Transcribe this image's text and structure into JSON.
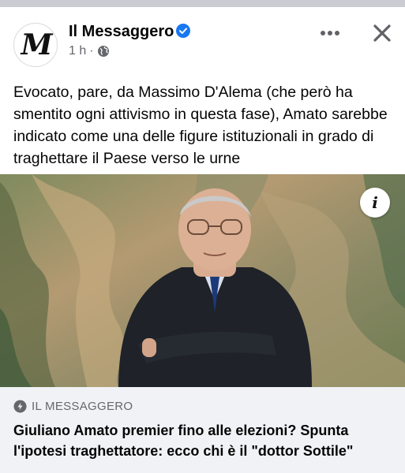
{
  "colors": {
    "verified_blue": "#1877f2",
    "meta_gray": "#65676b",
    "preview_bg": "#f0f2f5",
    "top_strip": "#c9ccd1"
  },
  "post": {
    "page_name": "Il Messaggero",
    "avatar_monogram": "M",
    "timestamp": "1 h",
    "separator": "·",
    "audience_icon": "globe-icon",
    "verified_icon": "verified-badge-icon",
    "more_icon": "more-dots-icon",
    "close_icon": "close-icon",
    "text": "Evocato, pare, da Massimo D'Alema (che però ha smentito ogni attivismo in questa fase), Amato sarebbe indicato come una delle figure istituzionali in grado di traghettare il Paese verso le urne"
  },
  "photo": {
    "info_icon": "info-icon",
    "info_glyph": "i"
  },
  "link_preview": {
    "domain": "IL MESSAGGERO",
    "domain_icon": "link-icon",
    "title": "Giuliano Amato premier fino alle elezioni? Spunta l'ipotesi traghettatore: ecco chi è il \"dottor Sottile\""
  }
}
